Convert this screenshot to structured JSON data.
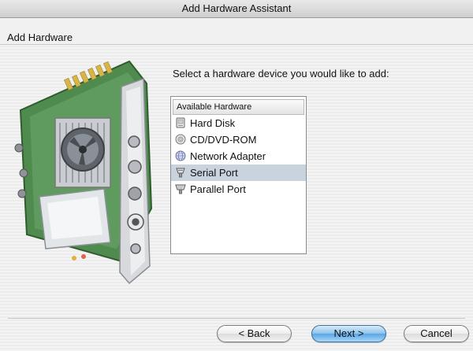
{
  "window": {
    "title": "Add Hardware Assistant"
  },
  "header": {
    "label": "Add Hardware"
  },
  "prompt": "Select a hardware device you would like to add:",
  "list": {
    "column_header": "Available Hardware",
    "items": [
      {
        "label": "Hard Disk",
        "icon": "hard-disk-icon",
        "selected": false
      },
      {
        "label": "CD/DVD-ROM",
        "icon": "cd-dvd-icon",
        "selected": false
      },
      {
        "label": "Network Adapter",
        "icon": "network-adapter-icon",
        "selected": false
      },
      {
        "label": "Serial Port",
        "icon": "serial-port-icon",
        "selected": true
      },
      {
        "label": "Parallel Port",
        "icon": "parallel-port-icon",
        "selected": false
      }
    ],
    "selected_color": "#c9d3dd"
  },
  "buttons": {
    "back": "< Back",
    "next": "Next >",
    "cancel": "Cancel"
  },
  "colors": {
    "default_button": "#5aa5e4"
  }
}
